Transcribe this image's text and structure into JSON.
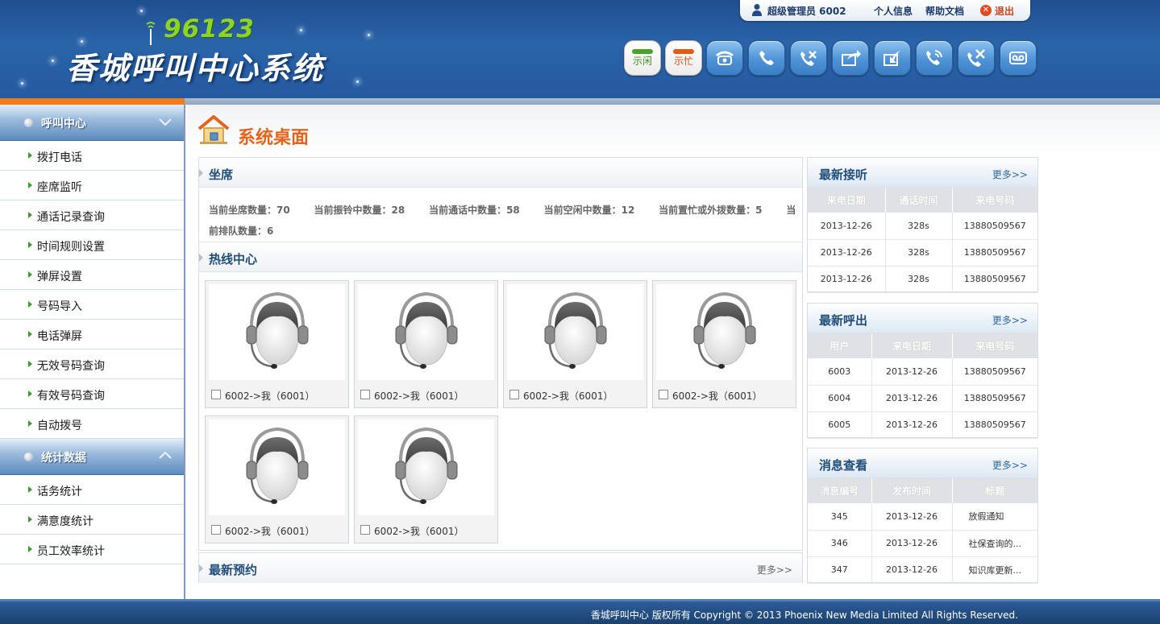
{
  "header": {
    "logo_number": "96123",
    "logo_title": "香城呼叫中心系统",
    "user": {
      "name": "超级管理员 6002",
      "profile": "个人信息",
      "help": "帮助文档",
      "logout": "退出"
    },
    "toolbar": {
      "idle": "示闲",
      "busy": "示忙",
      "icons": [
        "telephone-icon",
        "call-icon",
        "hangup-icon",
        "transfer-icon",
        "transfer-back-icon",
        "monitor-icon",
        "whisper-icon",
        "voicemail-icon"
      ]
    }
  },
  "sidebar": {
    "groups": [
      {
        "title": "呼叫中心",
        "items": [
          "拨打电话",
          "座席监听",
          "通话记录查询",
          "时间规则设置",
          "弹屏设置",
          "号码导入",
          "电话弹屏",
          "无效号码查询",
          "有效号码查询",
          "自动拨号"
        ]
      },
      {
        "title": "统计数据",
        "items": [
          "话务统计",
          "满意度统计",
          "员工效率统计"
        ]
      }
    ]
  },
  "main": {
    "page_title": "系统桌面",
    "seat_panel": {
      "title": "坐席",
      "stats": [
        "当前坐席数量：70",
        "当前振铃中数量：28",
        "当前通话中数量：58",
        "当前空闲中数量：12",
        "当前置忙或外拨数量：5",
        "当前排队数量：6"
      ]
    },
    "hotline_panel": {
      "title": "热线中心",
      "agents": [
        "6002->我（6001）",
        "6002->我（6001）",
        "6002->我（6001）",
        "6002->我（6001）",
        "6002->我（6001）",
        "6002->我（6001）"
      ]
    },
    "reserve_panel": {
      "title": "最新预约",
      "more": "更多>>"
    },
    "latest_listen": {
      "title": "最新接听",
      "more": "更多>>",
      "headers": [
        "来电日期",
        "通话时间",
        "来电号码"
      ],
      "rows": [
        [
          "2013-12-26",
          "328s",
          "13880509567"
        ],
        [
          "2013-12-26",
          "328s",
          "13880509567"
        ],
        [
          "2013-12-26",
          "328s",
          "13880509567"
        ]
      ]
    },
    "latest_out": {
      "title": "最新呼出",
      "more": "更多>>",
      "headers": [
        "用户",
        "来电日期",
        "来电号码"
      ],
      "rows": [
        [
          "6003",
          "2013-12-26",
          "13880509567"
        ],
        [
          "6004",
          "2013-12-26",
          "13880509567"
        ],
        [
          "6005",
          "2013-12-26",
          "13880509567"
        ]
      ]
    },
    "messages": {
      "title": "消息查看",
      "more": "更多>>",
      "headers": [
        "消息编号",
        "发布时间",
        "标题"
      ],
      "rows": [
        [
          "345",
          "2013-12-26",
          "放假通知"
        ],
        [
          "346",
          "2013-12-26",
          "社保查询的..."
        ],
        [
          "347",
          "2013-12-26",
          "知识库更新..."
        ]
      ]
    }
  },
  "footer": {
    "text": "香城呼叫中心  版权所有    Copyright © 2013 Phoenix New Media Limited All Rights Reserved."
  },
  "colors": {
    "header_blue": "#2559a0",
    "accent_orange": "#f47a1e",
    "title_orange": "#e5631a",
    "logo_green": "#8ed32a"
  }
}
